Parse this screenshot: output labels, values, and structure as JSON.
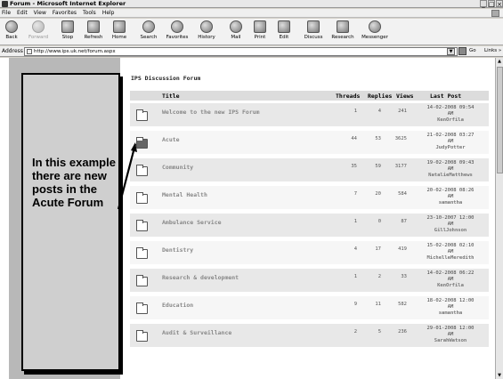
{
  "window": {
    "title": "Forum - Microsoft Internet Explorer",
    "controls": [
      "_",
      "□",
      "×"
    ]
  },
  "menu": [
    "File",
    "Edit",
    "View",
    "Favorites",
    "Tools",
    "Help"
  ],
  "toolbar": {
    "back": "Back",
    "forward": "Forward",
    "stop": "Stop",
    "refresh": "Refresh",
    "home": "Home",
    "search": "Search",
    "favorites": "Favorites",
    "history": "History",
    "mail": "Mail",
    "print": "Print",
    "edit": "Edit",
    "discuss": "Discuss",
    "research": "Research",
    "messenger": "Messenger"
  },
  "address": {
    "label": "Address",
    "url": "http://www.ips.uk.net/forum.aspx",
    "go": "Go",
    "links": "Links »"
  },
  "callout": {
    "text": "In this example there are new posts in the Acute Forum"
  },
  "forum": {
    "heading": "IPS Discussion Forum",
    "columns": {
      "title": "Title",
      "threads": "Threads",
      "replies": "Replies",
      "views": "Views",
      "last_post": "Last Post"
    },
    "rows": [
      {
        "title": "Welcome to the new IPS Forum",
        "threads": "1",
        "replies": "4",
        "views": "241",
        "date": "14-02-2008 09:54",
        "ampm": "AM",
        "user": "KenOrfila",
        "has_new": false
      },
      {
        "title": "Acute",
        "threads": "44",
        "replies": "53",
        "views": "3625",
        "date": "21-02-2008 03:27",
        "ampm": "AM",
        "user": "JudyPotter",
        "has_new": true
      },
      {
        "title": "Community",
        "threads": "35",
        "replies": "59",
        "views": "3177",
        "date": "19-02-2008 09:43",
        "ampm": "AM",
        "user": "NatalieMatthews",
        "has_new": false
      },
      {
        "title": "Mental Health",
        "threads": "7",
        "replies": "20",
        "views": "584",
        "date": "20-02-2008 08:26",
        "ampm": "AM",
        "user": "samantha",
        "has_new": false
      },
      {
        "title": "Ambulance Service",
        "threads": "1",
        "replies": "0",
        "views": "87",
        "date": "23-10-2007 12:00",
        "ampm": "AM",
        "user": "GillJohnson",
        "has_new": false
      },
      {
        "title": "Dentistry",
        "threads": "4",
        "replies": "17",
        "views": "419",
        "date": "15-02-2008 02:10",
        "ampm": "AM",
        "user": "MichelleMeredith",
        "has_new": false
      },
      {
        "title": "Research & development",
        "threads": "1",
        "replies": "2",
        "views": "33",
        "date": "14-02-2008 06:22",
        "ampm": "AM",
        "user": "KenOrfila",
        "has_new": false
      },
      {
        "title": "Education",
        "threads": "9",
        "replies": "11",
        "views": "582",
        "date": "18-02-2008 12:00",
        "ampm": "AM",
        "user": "samantha",
        "has_new": false
      },
      {
        "title": "Audit & Surveillance",
        "threads": "2",
        "replies": "5",
        "views": "236",
        "date": "29-01-2008 12:00",
        "ampm": "AM",
        "user": "SarahWatson",
        "has_new": false
      }
    ]
  }
}
